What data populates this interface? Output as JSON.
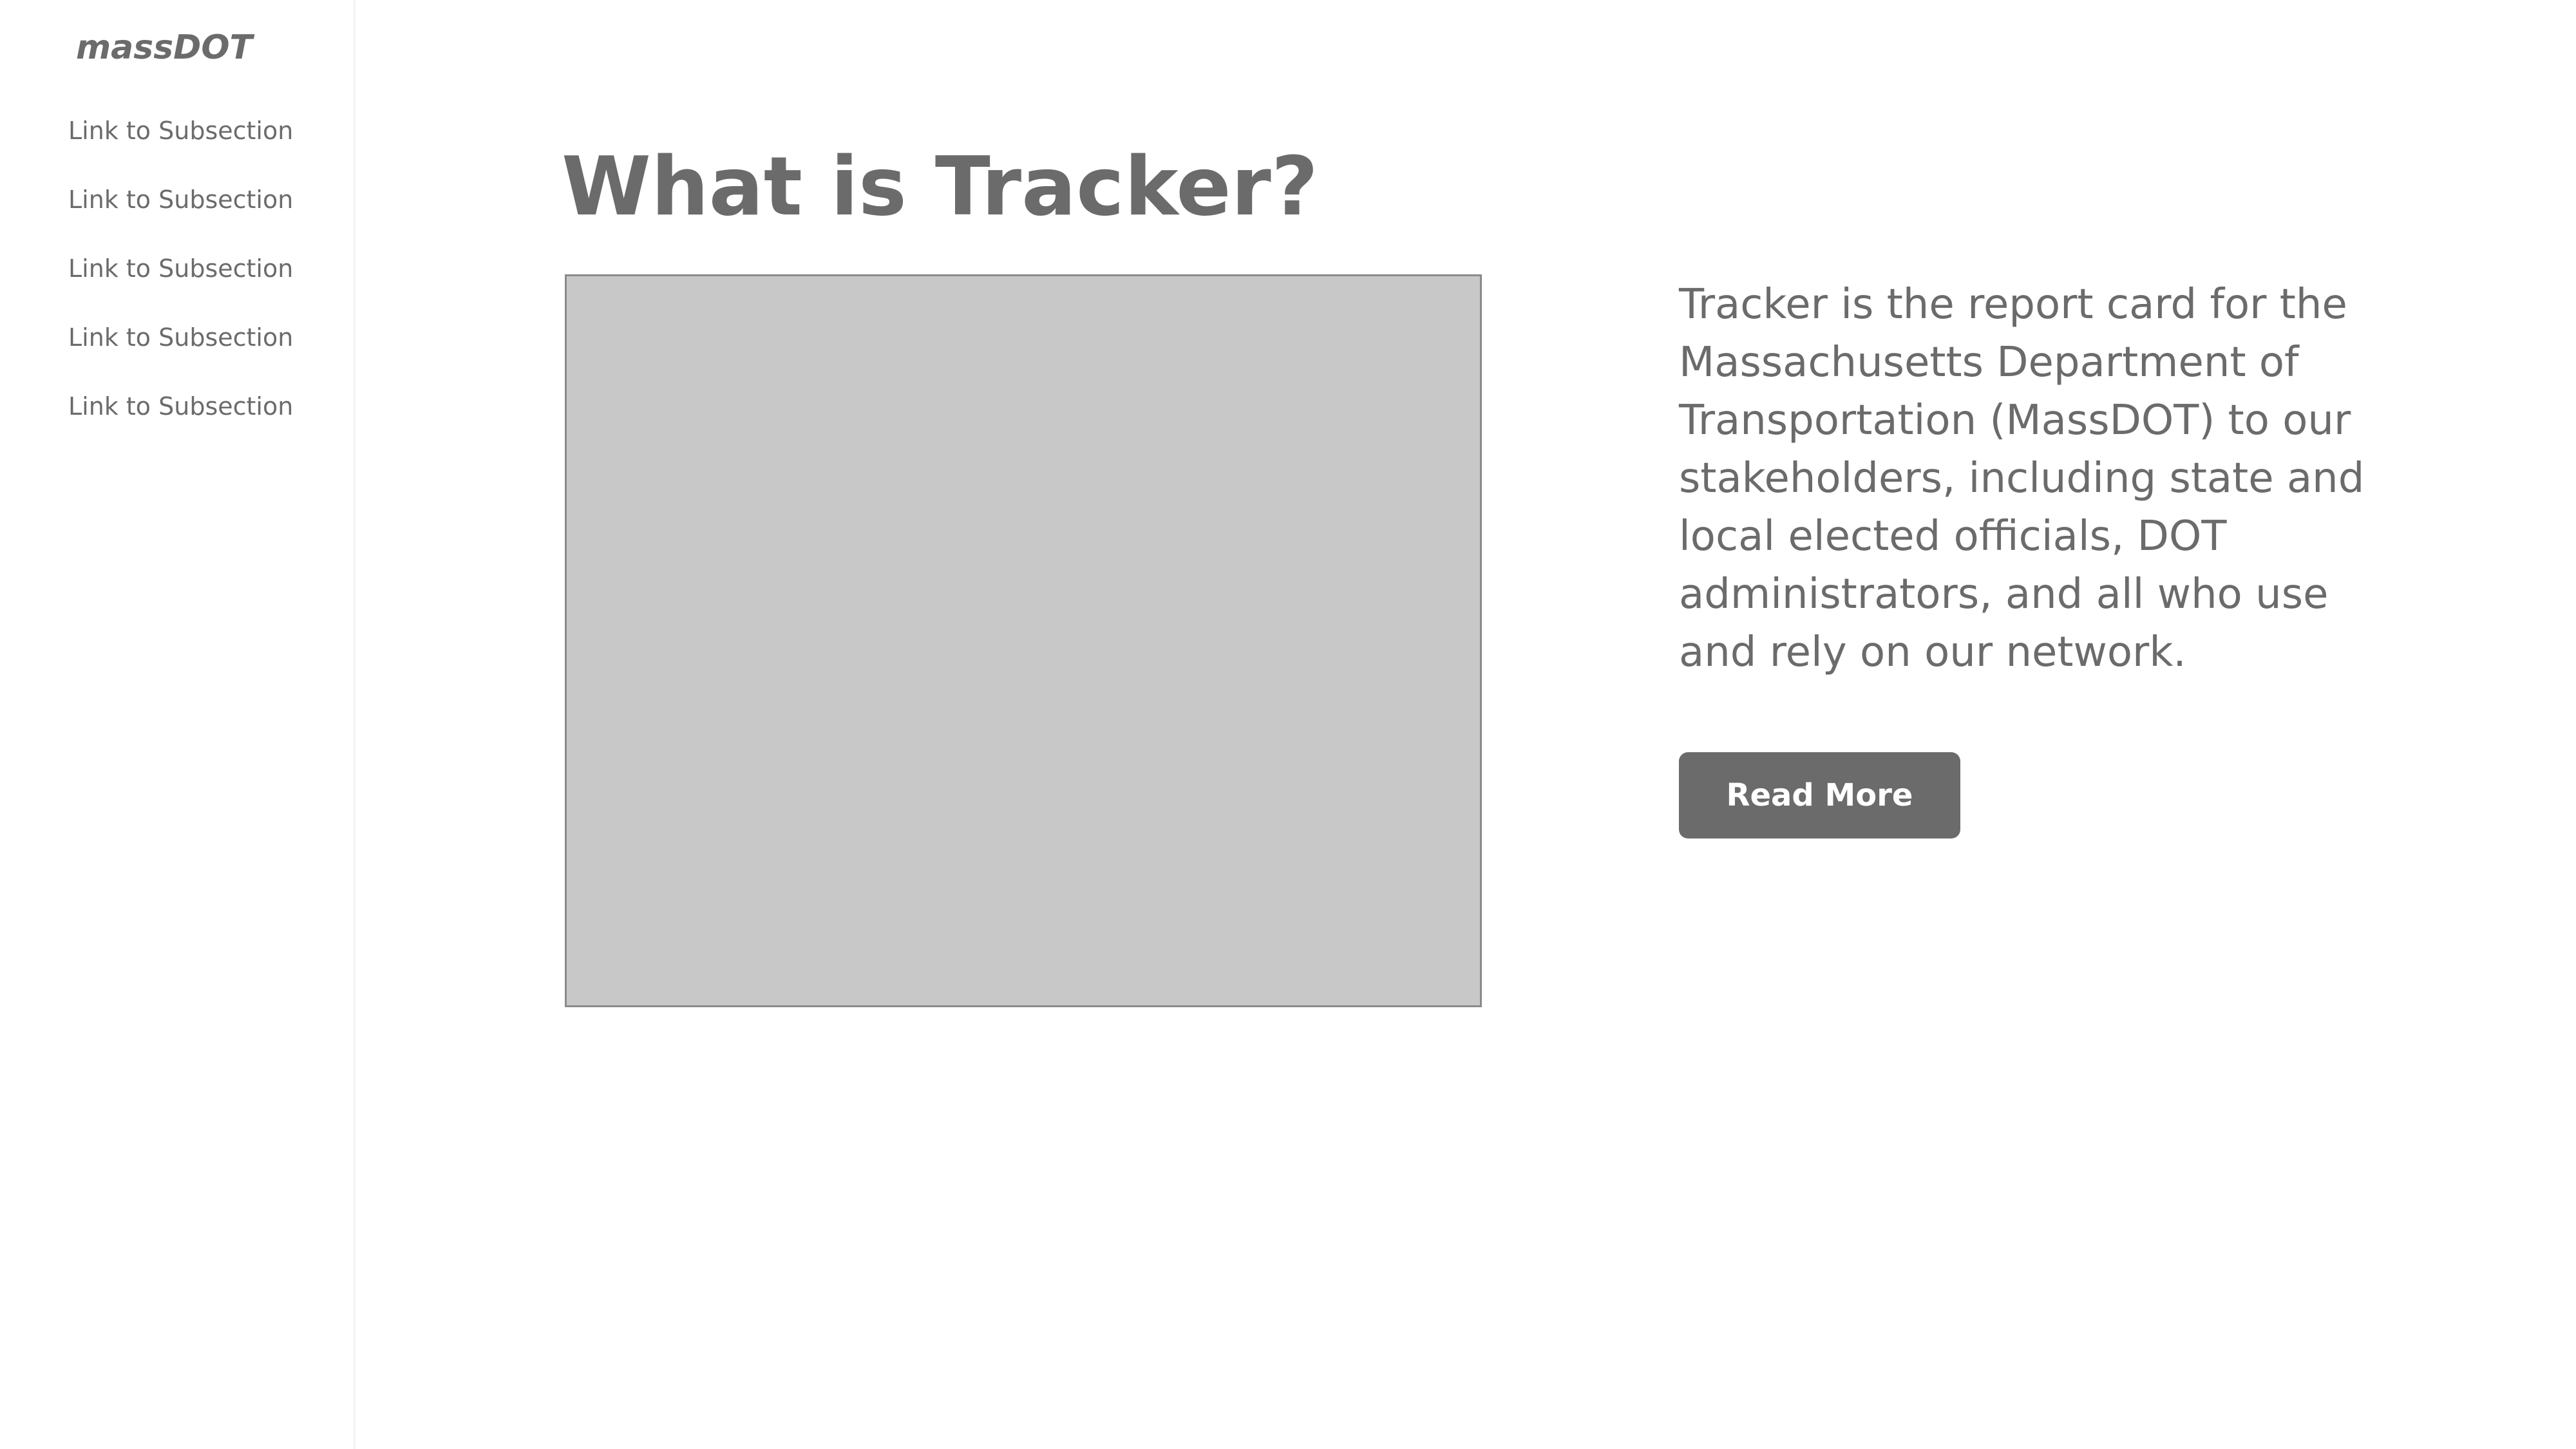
{
  "sidebar": {
    "logo": "massDOT",
    "items": [
      {
        "label": "Link to Subsection"
      },
      {
        "label": "Link to Subsection"
      },
      {
        "label": "Link to Subsection"
      },
      {
        "label": "Link to Subsection"
      },
      {
        "label": "Link to Subsection"
      }
    ]
  },
  "main": {
    "title": "What is Tracker?",
    "description": "Tracker is the report card for the Massachusetts Department of Transportation (MassDOT) to our stakeholders, including state and local elected officials, DOT administrators, and all who use and rely on our network.",
    "read_more_label": "Read More"
  },
  "colors": {
    "text": "#6b6b6b",
    "placeholder": "#c8c8c8",
    "button": "#6b6b6b",
    "background": "#ffffff"
  }
}
